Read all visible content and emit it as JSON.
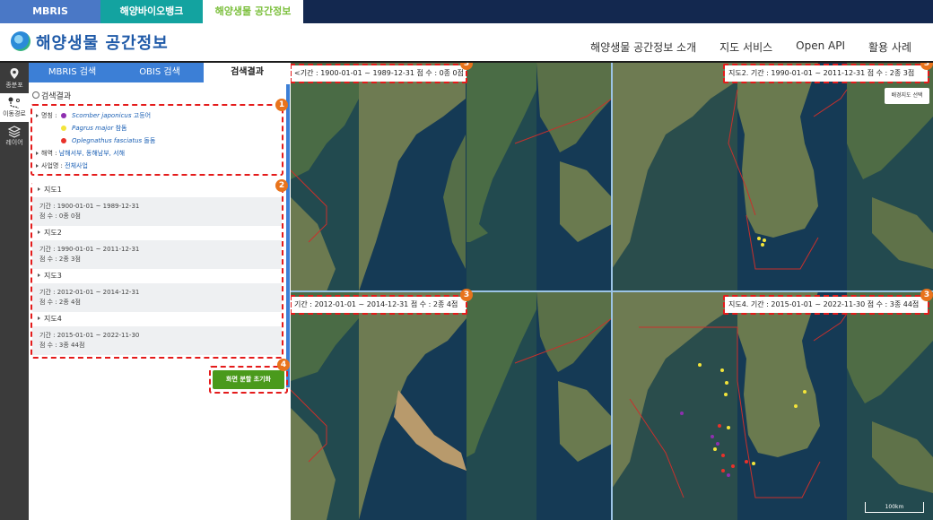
{
  "site_tabs": [
    "MBRIS",
    "해양바이오뱅크",
    "해양생물 공간정보"
  ],
  "header": {
    "title": "해양생물 공간정보",
    "nav": [
      "해양생물 공간정보 소개",
      "지도 서비스",
      "Open API",
      "활용 사례"
    ]
  },
  "icon_strip": [
    {
      "label": "종분포",
      "icon": "species-distribution-icon"
    },
    {
      "label": "이동경로",
      "icon": "route-icon"
    },
    {
      "label": "레이어",
      "icon": "layers-icon"
    }
  ],
  "panel": {
    "tabs": [
      "MBRIS 검색",
      "OBIS 검색",
      "검색결과"
    ],
    "search_title": "검색결과",
    "criteria": {
      "species_label": "명칭 :",
      "species": [
        {
          "sci": "Scomber japonicus",
          "kor": "고등어",
          "color": "#8e2fb0"
        },
        {
          "sci": "Pagrus major",
          "kor": "참돔",
          "color": "#f3e43a"
        },
        {
          "sci": "Oplegnathus fasciatus",
          "kor": "돌돔",
          "color": "#e8312a"
        }
      ],
      "sea_label": "해역 :",
      "sea_value": "남해서부, 동해남부, 서해",
      "project_label": "사업명 :",
      "project_value": "전체사업"
    },
    "maps": [
      {
        "name": "지도1",
        "period": "기간 : 1900-01-01 ~ 1989-12-31",
        "count": "점 수 : 0종 0점"
      },
      {
        "name": "지도2",
        "period": "기간 : 1990-01-01 ~ 2011-12-31",
        "count": "점 수 : 2종 3점"
      },
      {
        "name": "지도3",
        "period": "기간 : 2012-01-01 ~ 2014-12-31",
        "count": "점 수 : 2종 4점"
      },
      {
        "name": "지도4",
        "period": "기간 : 2015-01-01 ~ 2022-11-30",
        "count": "점 수 : 3종 44점"
      }
    ],
    "reset_button": "화면 분할 초기화"
  },
  "badges": {
    "b1": "1",
    "b2": "2",
    "b3": "3",
    "b4": "4"
  },
  "map_labels": {
    "m1": "<기간 : 1900-01-01 ~ 1989-12-31    점 수 : 0종 0점",
    "m2": "지도2.   기간 : 1990-01-01 ~ 2011-12-31   점 수 : 2종 3점",
    "m3": "기간 : 2012-01-01 ~ 2014-12-31    점 수 : 2종 4점",
    "m4": "지도4.   기간 : 2015-01-01 ~ 2022-11-30   점 수 : 3종 44점"
  },
  "basemap_button": "배경지도 선택",
  "scale": "100km"
}
